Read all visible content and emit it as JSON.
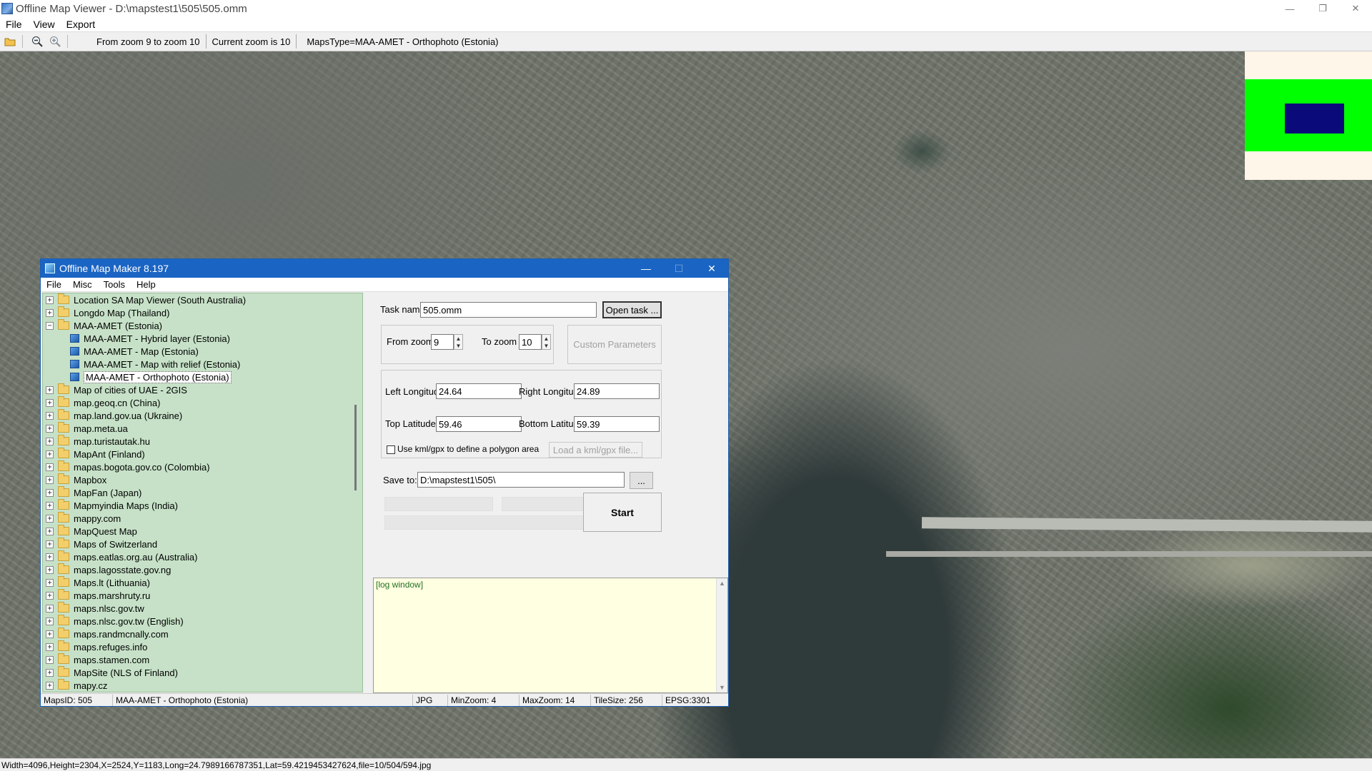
{
  "window": {
    "title": "Offline Map Viewer - D:\\mapstest1\\505\\505.omm",
    "minimize": "—",
    "restore": "❐",
    "close": "✕"
  },
  "menu": [
    "File",
    "View",
    "Export"
  ],
  "toolbar": {
    "zoom_range": "From zoom 9 to zoom 10",
    "current_zoom": "Current zoom is 10",
    "maps_type": "MapsType=MAA-AMET - Orthophoto (Estonia)"
  },
  "statusline": "Width=4096,Height=2304,X=2524,Y=1183,Long=24.7989166787351,Lat=59.4219453427624,file=10/504/594.jpg",
  "dialog": {
    "title": "Offline Map Maker 8.197",
    "minimize": "—",
    "maximize": "☐",
    "close": "✕",
    "menu": [
      "File",
      "Misc",
      "Tools",
      "Help"
    ],
    "tree": [
      {
        "label": "Location SA Map Viewer (South Australia)",
        "exp": "+"
      },
      {
        "label": "Longdo Map (Thailand)",
        "exp": "+"
      },
      {
        "label": "MAA-AMET (Estonia)",
        "exp": "−"
      },
      {
        "label": "MAA-AMET - Hybrid layer (Estonia)",
        "child": true
      },
      {
        "label": "MAA-AMET - Map (Estonia)",
        "child": true
      },
      {
        "label": "MAA-AMET - Map with relief (Estonia)",
        "child": true
      },
      {
        "label": "MAA-AMET - Orthophoto (Estonia)",
        "child": true,
        "selected": true
      },
      {
        "label": "Map of cities of UAE - 2GIS",
        "exp": "+"
      },
      {
        "label": "map.geoq.cn (China)",
        "exp": "+"
      },
      {
        "label": "map.land.gov.ua (Ukraine)",
        "exp": "+"
      },
      {
        "label": "map.meta.ua",
        "exp": "+"
      },
      {
        "label": "map.turistautak.hu",
        "exp": "+"
      },
      {
        "label": "MapAnt (Finland)",
        "exp": "+"
      },
      {
        "label": "mapas.bogota.gov.co (Colombia)",
        "exp": "+"
      },
      {
        "label": "Mapbox",
        "exp": "+"
      },
      {
        "label": "MapFan (Japan)",
        "exp": "+"
      },
      {
        "label": "Mapmyindia Maps (India)",
        "exp": "+"
      },
      {
        "label": "mappy.com",
        "exp": "+"
      },
      {
        "label": "MapQuest Map",
        "exp": "+"
      },
      {
        "label": "Maps of Switzerland",
        "exp": "+"
      },
      {
        "label": "maps.eatlas.org.au (Australia)",
        "exp": "+"
      },
      {
        "label": "maps.lagosstate.gov.ng",
        "exp": "+"
      },
      {
        "label": "Maps.lt (Lithuania)",
        "exp": "+"
      },
      {
        "label": "maps.marshruty.ru",
        "exp": "+"
      },
      {
        "label": "maps.nlsc.gov.tw",
        "exp": "+"
      },
      {
        "label": "maps.nlsc.gov.tw (English)",
        "exp": "+"
      },
      {
        "label": "maps.randmcnally.com",
        "exp": "+"
      },
      {
        "label": "maps.refuges.info",
        "exp": "+"
      },
      {
        "label": "maps.stamen.com",
        "exp": "+"
      },
      {
        "label": "MapSite (NLS of Finland)",
        "exp": "+"
      },
      {
        "label": "mapy.cz",
        "exp": "+"
      }
    ],
    "task_name_label": "Task name",
    "task_name_value": "505.omm",
    "open_task": "Open task ...",
    "from_zoom_label": "From zoom",
    "from_zoom_value": "9",
    "to_zoom_label": "To zoom",
    "to_zoom_value": "10",
    "custom_params": "Custom Parameters",
    "left_lon_label": "Left Longitude",
    "left_lon_value": "24.64",
    "right_lon_label": "Right Longitude",
    "right_lon_value": "24.89",
    "top_lat_label": "Top Latitude",
    "top_lat_value": "59.46",
    "bottom_lat_label": "Bottom Latitude",
    "bottom_lat_value": "59.39",
    "kml_label": "Use kml/gpx to define a polygon area",
    "load_kml": "Load a kml/gpx file...",
    "save_to_label": "Save to:",
    "save_to_value": "D:\\mapstest1\\505\\",
    "browse": "...",
    "start": "Start",
    "log_text": "[log window]",
    "status": {
      "maps_id": "MapsID: 505",
      "map_name": "MAA-AMET - Orthophoto (Estonia)",
      "format": "JPG",
      "min_zoom": "MinZoom: 4",
      "max_zoom": "MaxZoom: 14",
      "tile_size": "TileSize: 256",
      "epsg": "EPSG:3301"
    }
  }
}
